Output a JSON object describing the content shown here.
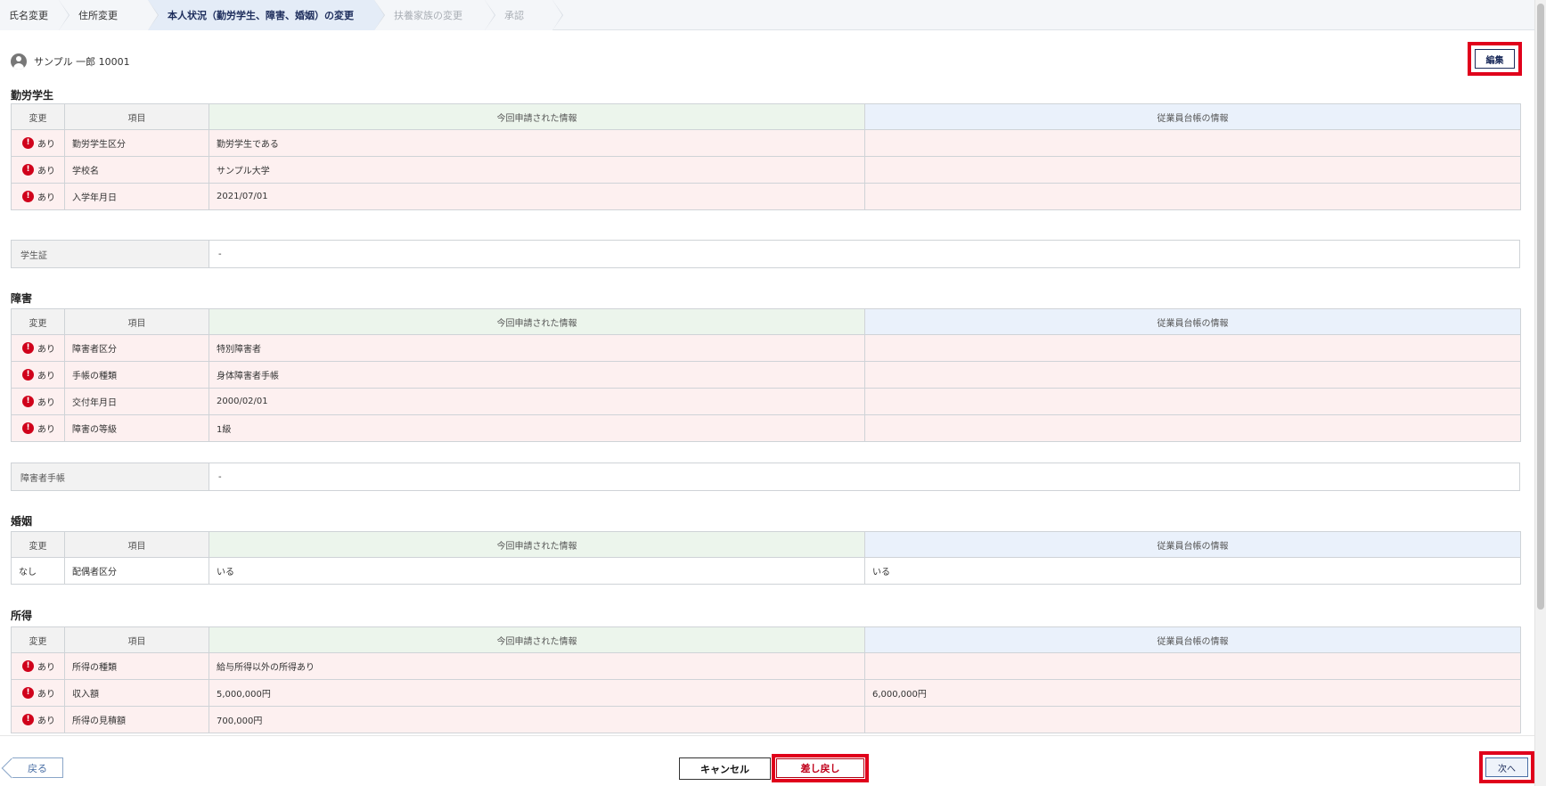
{
  "stepper": [
    {
      "label": "氏名変更",
      "state": "done"
    },
    {
      "label": "住所変更",
      "state": "done"
    },
    {
      "label": "本人状況（勤労学生、障害、婚姻）の変更",
      "state": "active"
    },
    {
      "label": "扶養家族の変更",
      "state": "disabled"
    },
    {
      "label": "承認",
      "state": "disabled"
    }
  ],
  "user": {
    "name": "サンプル 一郎 10001",
    "icon": "user-avatar-icon"
  },
  "edit_label": "編集",
  "table_headers": {
    "change": "変更",
    "item": "項目",
    "new_info": "今回申請された情報",
    "current_info": "従業員台帳の情報"
  },
  "change_yes": "あり",
  "change_no": "なし",
  "sections": {
    "student": {
      "title": "勤労学生",
      "rows": [
        {
          "item": "勤労学生区分",
          "new": "勤労学生である",
          "current": ""
        },
        {
          "item": "学校名",
          "new": "サンプル大学",
          "current": ""
        },
        {
          "item": "入学年月日",
          "new": "2021/07/01",
          "current": ""
        }
      ],
      "attachment": {
        "label": "学生証",
        "value": "-"
      }
    },
    "disability": {
      "title": "障害",
      "rows": [
        {
          "item": "障害者区分",
          "new": "特別障害者",
          "current": ""
        },
        {
          "item": "手帳の種類",
          "new": "身体障害者手帳",
          "current": ""
        },
        {
          "item": "交付年月日",
          "new": "2000/02/01",
          "current": ""
        },
        {
          "item": "障害の等級",
          "new": "1級",
          "current": ""
        }
      ],
      "attachment": {
        "label": "障害者手帳",
        "value": "-"
      }
    },
    "marriage": {
      "title": "婚姻",
      "rows": [
        {
          "item": "配偶者区分",
          "new": "いる",
          "current": "いる"
        }
      ]
    },
    "income": {
      "title": "所得",
      "rows": [
        {
          "item": "所得の種類",
          "new": "給与所得以外の所得あり",
          "current": ""
        },
        {
          "item": "収入額",
          "new": "5,000,000円",
          "current": "6,000,000円"
        },
        {
          "item": "所得の見積額",
          "new": "700,000円",
          "current": ""
        }
      ]
    }
  },
  "footer": {
    "back": "戻る",
    "cancel": "キャンセル",
    "send_back": "差し戻し",
    "next": "次へ"
  },
  "colors": {
    "accent": "#1d2d5c",
    "highlight": "#e0001b",
    "changed_row": "#fdf0f0",
    "alert": "#d0021b"
  }
}
